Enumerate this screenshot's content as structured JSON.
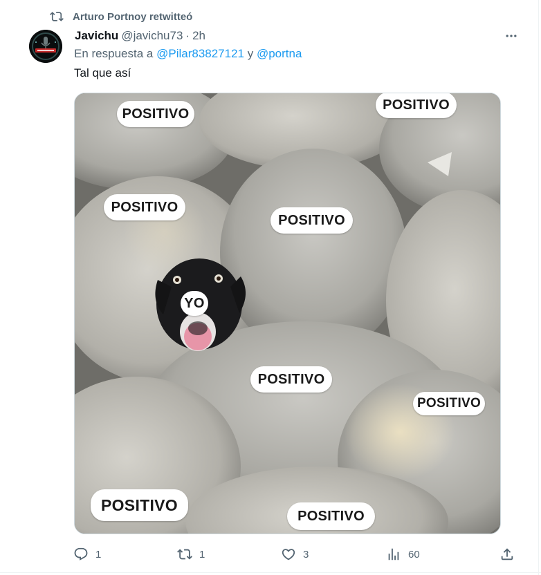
{
  "retweet": {
    "text": "Arturo Portnoy retwitteó",
    "icon": "retweet-icon"
  },
  "author": {
    "name": "Javichu",
    "handle": "@javichu73",
    "separator": "·",
    "time": "2h",
    "avatar": "avatar"
  },
  "reply": {
    "prefix": "En respuesta a",
    "user1": "@Pilar83827121",
    "conj": "y",
    "user2": "@portna"
  },
  "tweet": {
    "text": "Tal que así"
  },
  "media": {
    "labels": [
      "POSITIVO",
      "POSITIVO",
      "POSITIVO",
      "POSITIVO",
      "YO",
      "POSITIVO",
      "POSITIVO",
      "POSITIVO",
      "POSITIVO"
    ]
  },
  "actions": {
    "replies": "1",
    "retweets": "1",
    "likes": "3",
    "views": "60"
  },
  "colors": {
    "link": "#1d9bf0",
    "secondary": "#536471",
    "text": "#0f1419"
  }
}
